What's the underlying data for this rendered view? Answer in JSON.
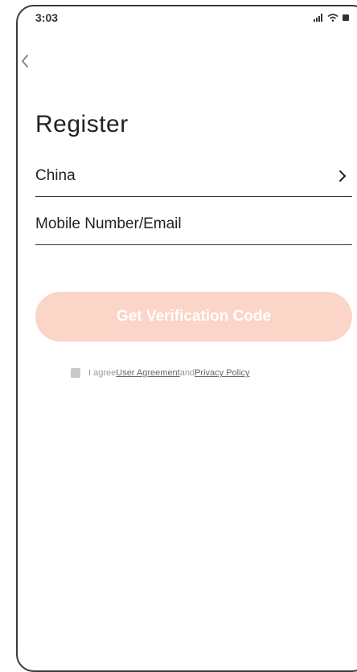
{
  "status_bar": {
    "time": "3:03",
    "icons": [
      "signal-icon",
      "wifi-icon",
      "battery-icon"
    ]
  },
  "nav": {
    "back_icon": "chevron-left-icon"
  },
  "page": {
    "title": "Register"
  },
  "form": {
    "country": {
      "value": "China",
      "icon": "chevron-right-icon"
    },
    "account": {
      "placeholder": "Mobile Number/Email"
    }
  },
  "actions": {
    "get_code_label": "Get Verification Code",
    "button_color": "#fbd5c8"
  },
  "agreement": {
    "prefix": "I agree",
    "user_agreement": "User Agreement",
    "conjunction": "and",
    "privacy_policy": "Privacy Policy"
  }
}
